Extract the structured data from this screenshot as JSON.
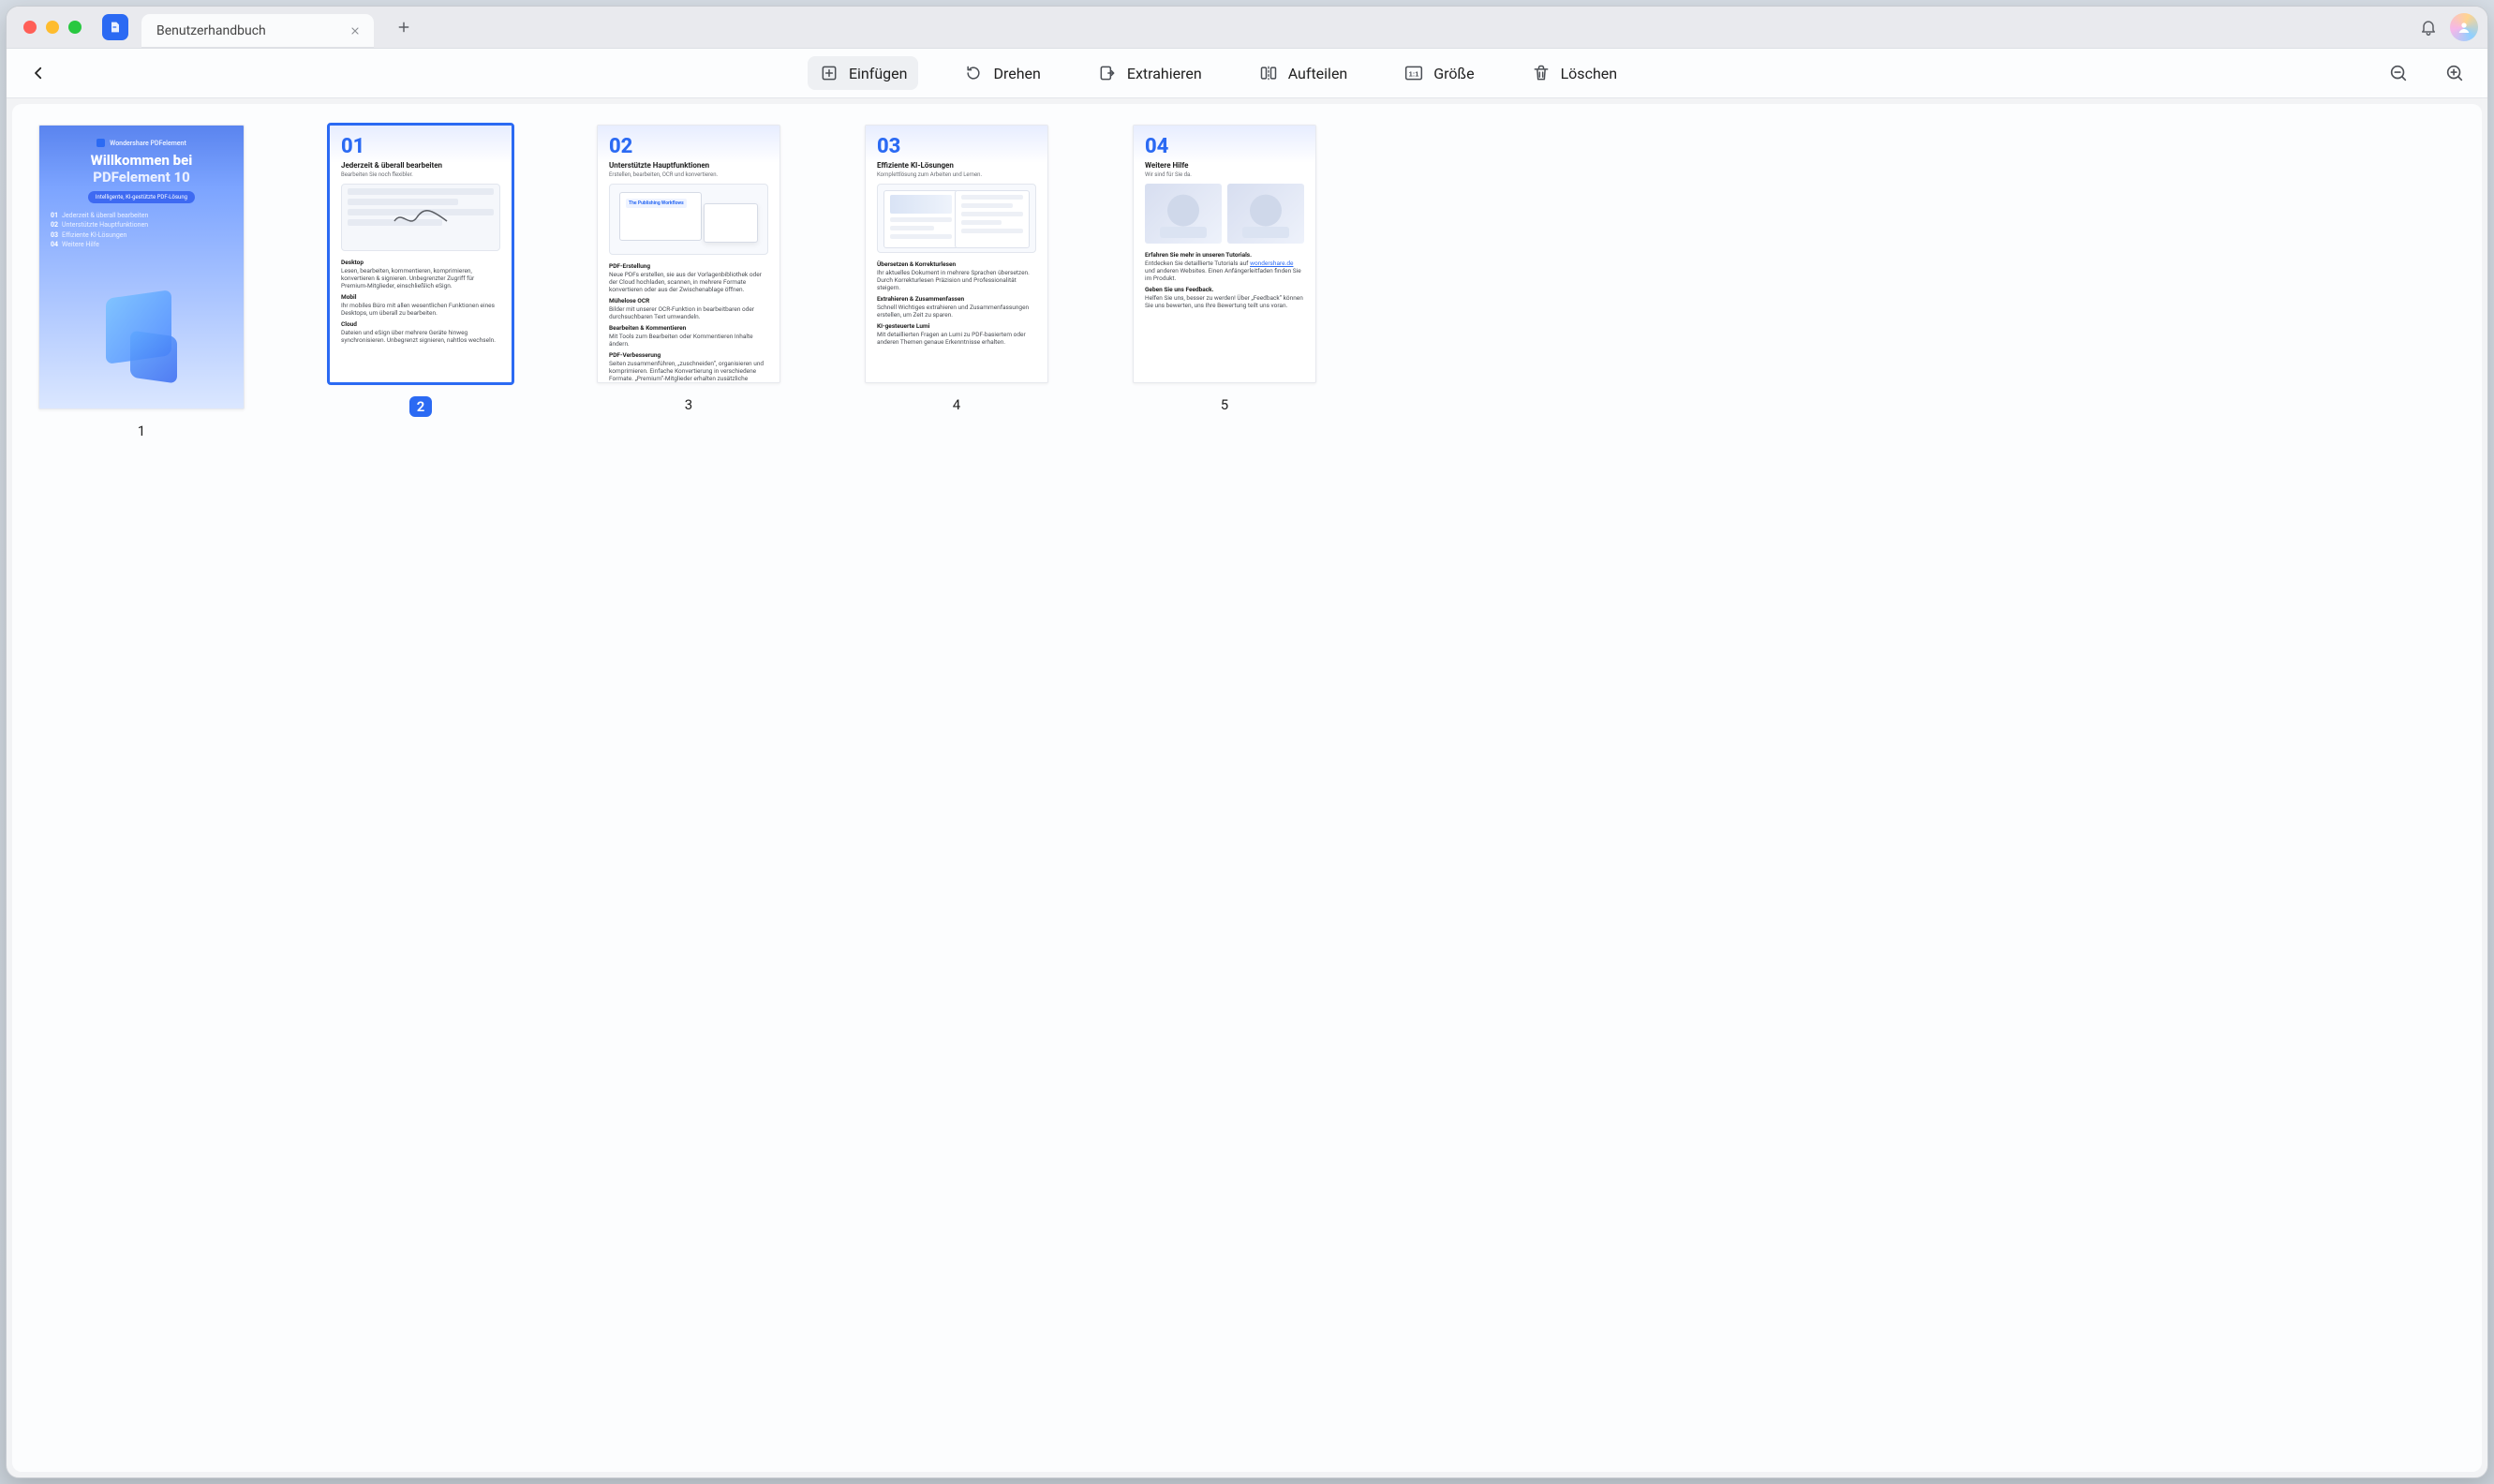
{
  "window": {
    "tab_title": "Benutzerhandbuch"
  },
  "toolbar": {
    "insert": "Einfügen",
    "rotate": "Drehen",
    "extract": "Extrahieren",
    "split": "Aufteilen",
    "size": "Größe",
    "delete": "Löschen"
  },
  "pages": {
    "p1": {
      "num_label": "1",
      "brand": "Wondershare PDFelement",
      "title_line1": "Willkommen bei",
      "title_line2": "PDFelement 10",
      "pill": "Intelligente, KI-gestützte PDF-Lösung",
      "toc": {
        "i1n": "01",
        "i1": "Jederzeit & überall bearbeiten",
        "i2n": "02",
        "i2": "Unterstützte Hauptfunktionen",
        "i3n": "03",
        "i3": "Effiziente KI-Lösungen",
        "i4n": "04",
        "i4": "Weitere Hilfe"
      }
    },
    "p2": {
      "num_label": "2",
      "big": "01",
      "title": "Jederzeit & überall bearbeiten",
      "sub": "Bearbeiten Sie noch flexibler.",
      "s1t": "Desktop",
      "s1b": "Lesen, bearbeiten, kommentieren, komprimieren, konvertieren & signieren. Unbegrenzter Zugriff für Premium-Mitglieder, einschließlich eSign.",
      "s2t": "Mobil",
      "s2b": "Ihr mobiles Büro mit allen wesentlichen Funktionen eines Desktops, um überall zu bearbeiten.",
      "s3t": "Cloud",
      "s3b": "Dateien und eSign über mehrere Geräte hinweg synchronisieren. Unbegrenzt signieren, nahtlos wechseln."
    },
    "p3": {
      "num_label": "3",
      "big": "02",
      "title": "Unterstützte Hauptfunktionen",
      "sub": "Erstellen, bearbeiten, OCR und konvertieren.",
      "mock_tag": "The Publishing Workflows",
      "s1t": "PDF-Erstellung",
      "s1b": "Neue PDFs erstellen, sie aus der Vorlagenbibliothek oder der Cloud hochladen, scannen, in mehrere Formate konvertieren oder aus der Zwischenablage öffnen.",
      "s2t": "Mühelose OCR",
      "s2b": "Bilder mit unserer OCR-Funktion in bearbeitbaren oder durchsuchbaren Text umwandeln.",
      "s3t": "Bearbeiten & Kommentieren",
      "s3b": "Mit Tools zum Bearbeiten oder Kommentieren Inhalte ändern.",
      "s4t": "PDF-Verbesserung",
      "s4b": "Seiten zusammenführen, „zuschneiden“, organisieren und komprimieren. Einfache Konvertierung in verschiedene Formate. „Premium“-Mitglieder erhalten zusätzliche Vorteile."
    },
    "p4": {
      "num_label": "4",
      "big": "03",
      "title": "Effiziente  KI-Lösungen",
      "sub": "Komplettlösung zum Arbeiten und Lernen.",
      "s1t": "Übersetzen & Korrekturlesen",
      "s1b": "Ihr aktuelles Dokument in mehrere Sprachen übersetzen. Durch Korrekturlesen Präzision und Professionalität steigern.",
      "s2t": "Extrahieren & Zusammenfassen",
      "s2b": "Schnell Wichtiges extrahieren und Zusammenfassungen erstellen, um Zeit zu sparen.",
      "s3t": "KI-gesteuerte Lumi",
      "s3b": "Mit detaillierten Fragen an Lumi zu PDF-basiertem oder anderen Themen genaue Erkenntnisse erhalten."
    },
    "p5": {
      "num_label": "5",
      "big": "04",
      "title": "Weitere Hilfe",
      "sub": "Wir sind für Sie da.",
      "s1t": "Erfahren Sie mehr in unseren Tutorials.",
      "s1b_pre": "Entdecken Sie detaillierte Tutorials auf ",
      "s1b_link": "wondershare.de",
      "s1b_post": " und anderen Websites. Einen Anfängerleitfaden finden Sie im Produkt.",
      "s2t": "Geben Sie uns Feedback.",
      "s2b": "Helfen Sie uns, besser zu werden! Über „Feedback“ können Sie uns bewerten, uns Ihre Bewertung teilt uns voran."
    }
  }
}
